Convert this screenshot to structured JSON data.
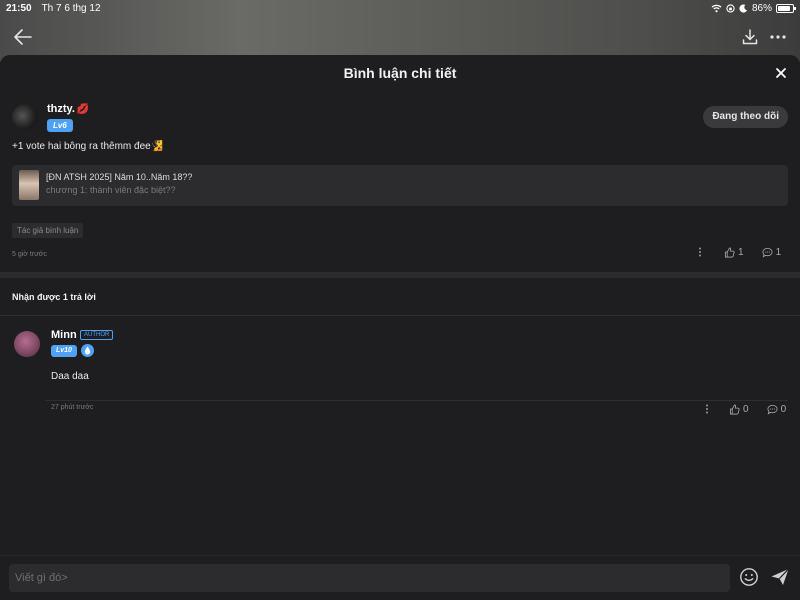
{
  "status_bar": {
    "time": "21:50",
    "date": "Th 7 6 thg 12",
    "battery": "86%",
    "battery_level": 0.86
  },
  "sheet": {
    "title": "Bình luận chi tiết"
  },
  "main_comment": {
    "user_name": "thzty.",
    "level": "Lv6",
    "follow_label": "Đang theo dõi",
    "text": "+1 vote hai bông ra thêmm đee",
    "story": {
      "title": "[ĐN ATSH 2025] Năm 10..Năm 18??",
      "chapter": "chương 1: thành viên đặc biệt??"
    },
    "tag": "Tác giả bình luận",
    "time": "5 giờ trước",
    "likes": "1",
    "replies": "1"
  },
  "replies_header": "Nhận được 1 trả lời",
  "reply": {
    "user_name": "Minn",
    "author_badge": "AUTHOR",
    "level": "Lv10",
    "text": "Daa daa",
    "time": "27 phút trước",
    "likes": "0",
    "replies": "0"
  },
  "composer": {
    "placeholder": "Viết gì đó>"
  },
  "colors": {
    "accent": "#4ea1f3",
    "heart": "#ff4d6d",
    "background": "#1e1e20"
  },
  "icons": [
    "back-arrow-icon",
    "download-icon",
    "more-icon",
    "close-icon",
    "heart-icon",
    "like-icon",
    "reply-bubble-icon",
    "emoji-icon",
    "send-icon",
    "wifi-icon",
    "moon-icon",
    "drop-icon"
  ]
}
